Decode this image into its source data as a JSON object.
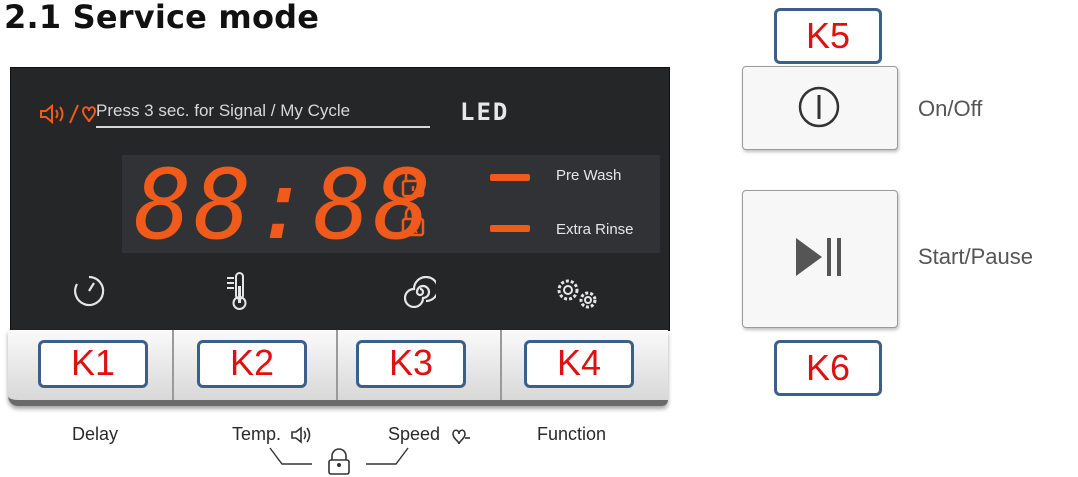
{
  "title": "2.1 Service mode",
  "panel": {
    "hint": "Press 3 sec. for Signal / My Cycle",
    "display_label": "LED",
    "time_digits": "88:88",
    "indicators": [
      "Pre Wash",
      "Extra Rinse"
    ]
  },
  "keys": [
    {
      "id": "K1",
      "label": "Delay"
    },
    {
      "id": "K2",
      "label": "Temp."
    },
    {
      "id": "K3",
      "label": "Speed"
    },
    {
      "id": "K4",
      "label": "Function"
    },
    {
      "id": "K5",
      "label": "On/Off"
    },
    {
      "id": "K6",
      "label": "Start/Pause"
    }
  ],
  "colors": {
    "led": "#f05a1a",
    "panel": "#252628",
    "key_text": "#e01010",
    "key_border": "#3c5f8a"
  }
}
